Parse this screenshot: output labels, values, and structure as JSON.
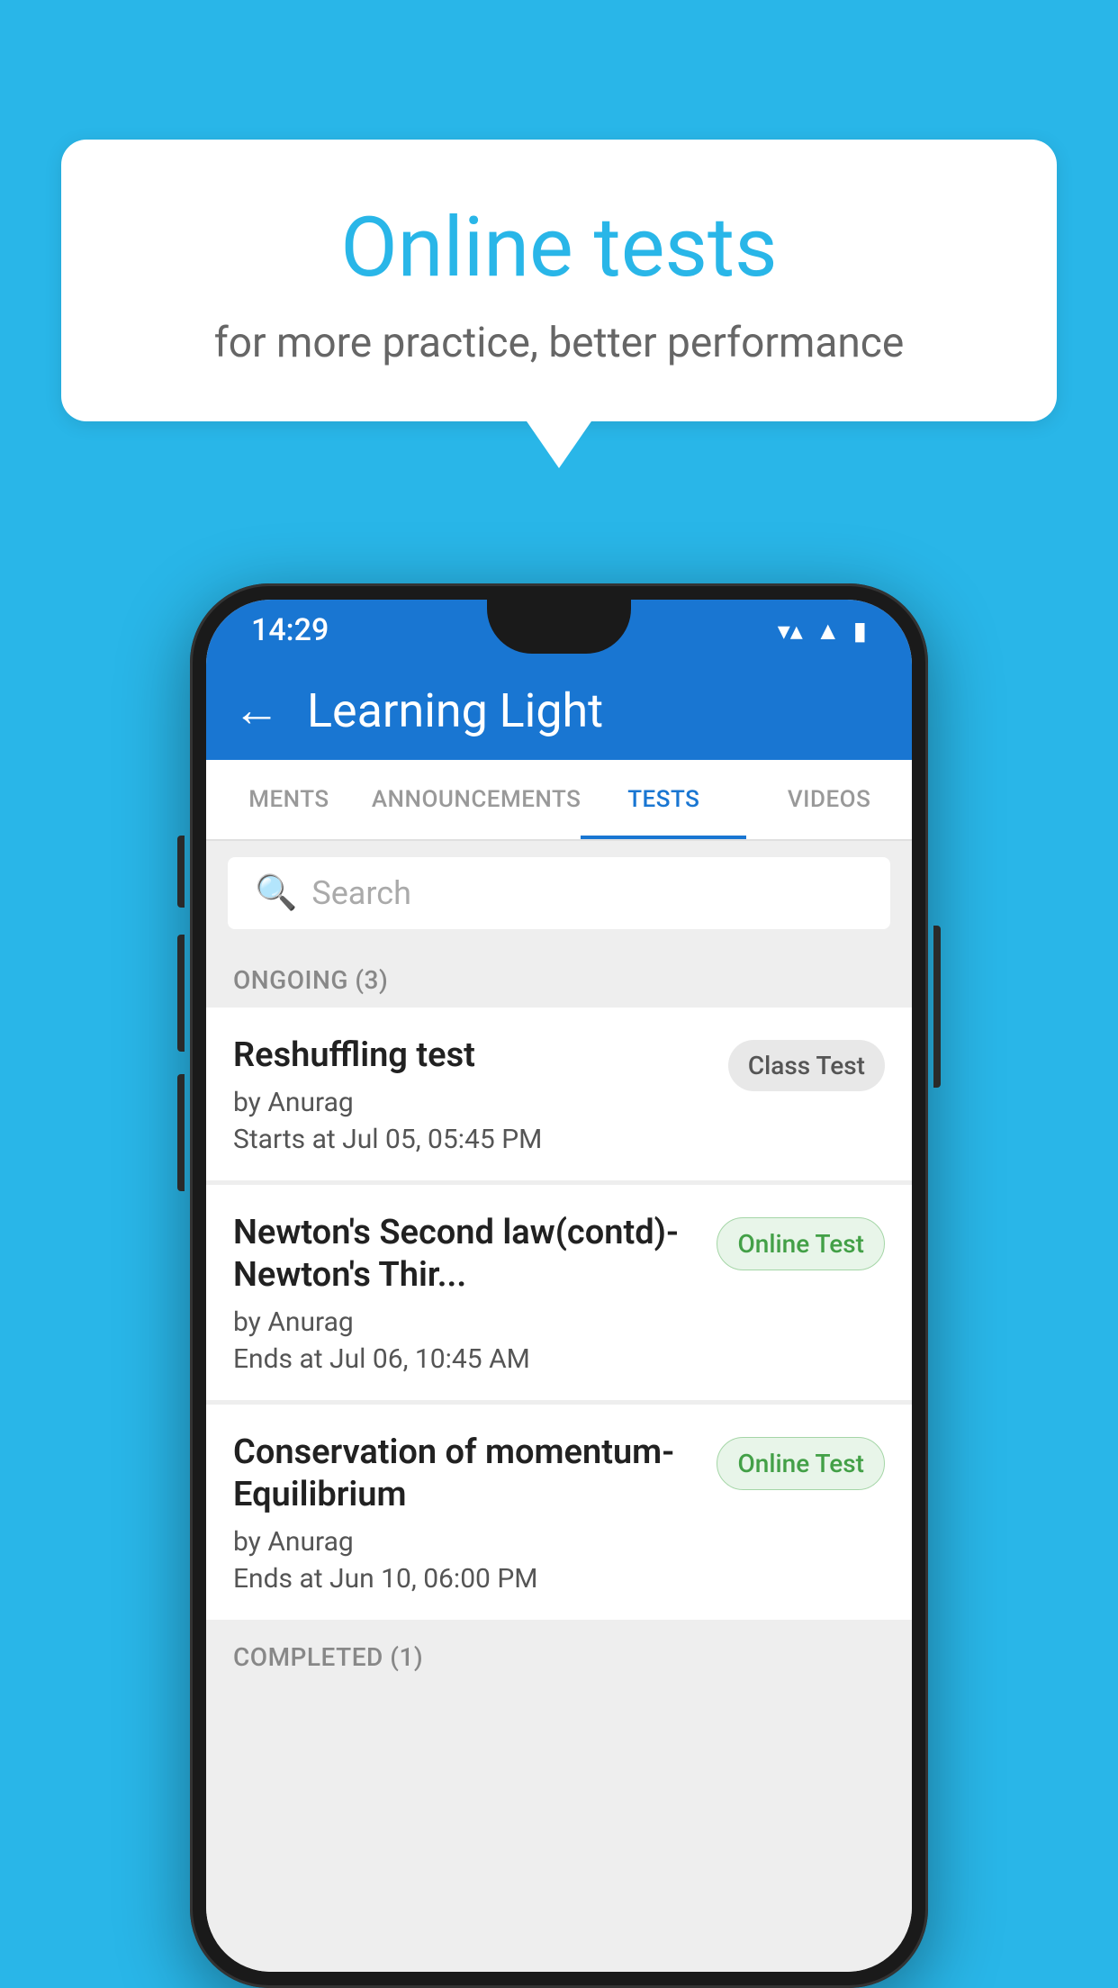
{
  "background_color": "#29b6e8",
  "speech_bubble": {
    "title": "Online tests",
    "subtitle": "for more practice, better performance"
  },
  "phone": {
    "status_bar": {
      "time": "14:29",
      "wifi_icon": "▼",
      "signal_icon": "▲",
      "battery_icon": "▮"
    },
    "app_bar": {
      "back_label": "←",
      "title": "Learning Light"
    },
    "tabs": [
      {
        "label": "MENTS",
        "active": false
      },
      {
        "label": "ANNOUNCEMENTS",
        "active": false
      },
      {
        "label": "TESTS",
        "active": true
      },
      {
        "label": "VIDEOS",
        "active": false
      }
    ],
    "search": {
      "placeholder": "Search"
    },
    "sections": [
      {
        "header": "ONGOING (3)",
        "tests": [
          {
            "name": "Reshuffling test",
            "author": "by Anurag",
            "date": "Starts at  Jul 05, 05:45 PM",
            "badge": "Class Test",
            "badge_type": "class"
          },
          {
            "name": "Newton's Second law(contd)-Newton's Thir...",
            "author": "by Anurag",
            "date": "Ends at  Jul 06, 10:45 AM",
            "badge": "Online Test",
            "badge_type": "online"
          },
          {
            "name": "Conservation of momentum-Equilibrium",
            "author": "by Anurag",
            "date": "Ends at  Jun 10, 06:00 PM",
            "badge": "Online Test",
            "badge_type": "online"
          }
        ]
      }
    ],
    "completed_header": "COMPLETED (1)"
  }
}
